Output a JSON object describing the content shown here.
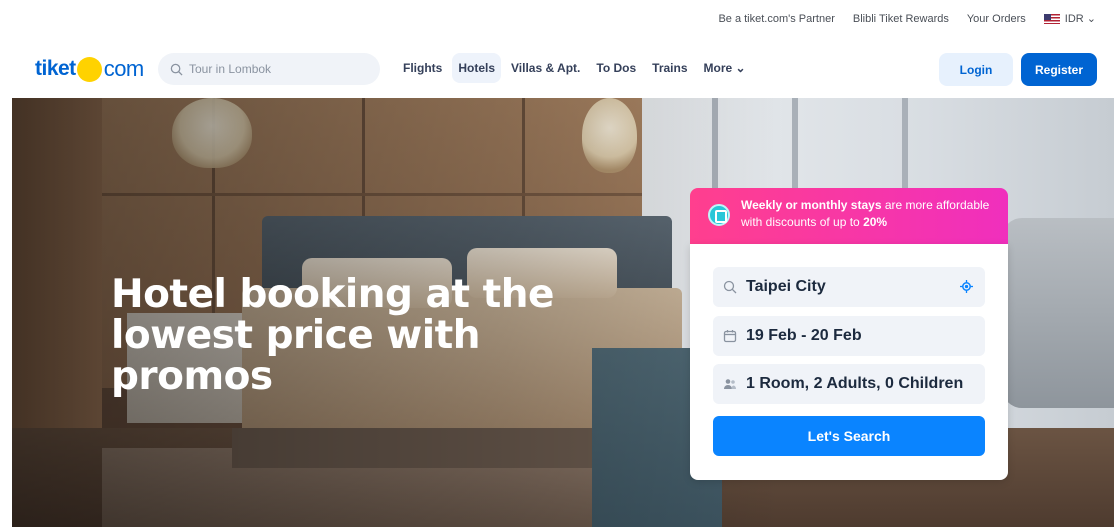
{
  "topbar": {
    "partner": "Be a tiket.com's Partner",
    "rewards": "Blibli Tiket Rewards",
    "orders": "Your Orders",
    "currency": "IDR"
  },
  "header": {
    "logo_left": "tiket",
    "logo_right": "com",
    "search_placeholder": "Tour in Lombok",
    "nav": [
      "Flights",
      "Hotels",
      "Villas & Apt.",
      "To Dos",
      "Trains",
      "More"
    ],
    "active_nav": "Hotels",
    "login": "Login",
    "register": "Register"
  },
  "hero": {
    "title": "Hotel booking at the lowest price with promos"
  },
  "promo": {
    "bold": "Weekly or monthly stays",
    "text": " are more affordable with discounts of up to ",
    "percent": "20%"
  },
  "booking": {
    "destination": "Taipei City",
    "dates": "19 Feb - 20 Feb",
    "guests": "1 Room, 2 Adults, 0 Children",
    "search_button": "Let's Search"
  },
  "colors": {
    "brand_blue": "#0064d2",
    "brand_yellow": "#ffd200",
    "promo_pink": "#ff3f8e",
    "cta_blue": "#0a84ff"
  }
}
